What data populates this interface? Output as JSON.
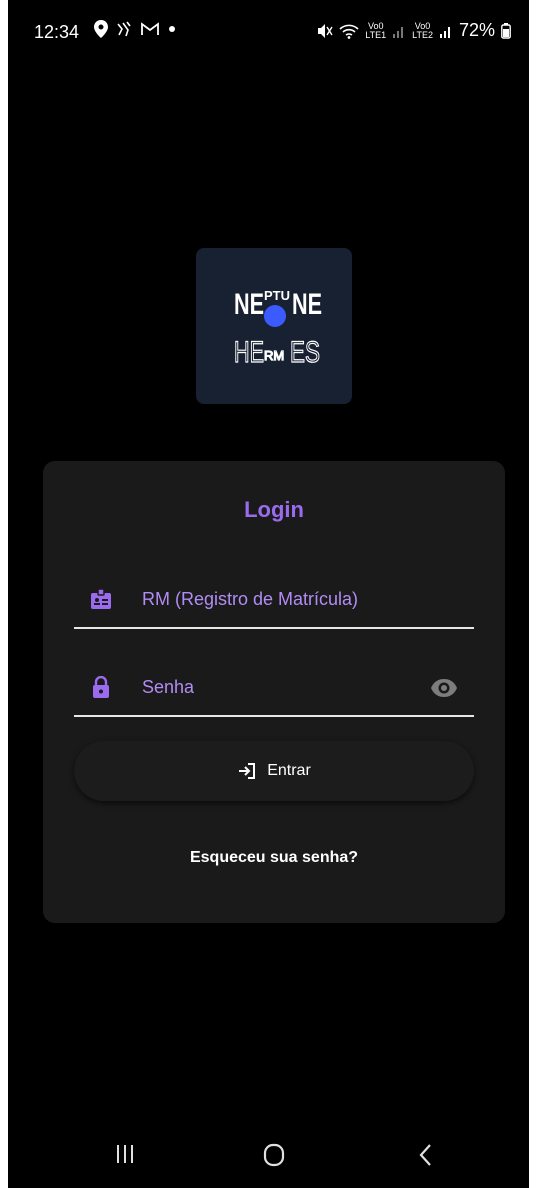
{
  "status_bar": {
    "time": "12:34",
    "battery": "72%",
    "volte1": "Vo0",
    "lte1": "LTE1",
    "volte2": "Vo0",
    "lte2": "LTE2"
  },
  "logo": {
    "line1_a": "NE",
    "line1_b": "PTU",
    "line1_c": "NE",
    "line2_a": "HE",
    "line2_b": "RM",
    "line2_c": "ES",
    "dot_color": "#3b5bff"
  },
  "login": {
    "title": "Login",
    "rm_label": "RM (Registro de Matrícula)",
    "password_label": "Senha",
    "submit_label": "Entrar",
    "forgot_label": "Esqueceu sua senha?",
    "accent_color": "#9b6bef"
  }
}
